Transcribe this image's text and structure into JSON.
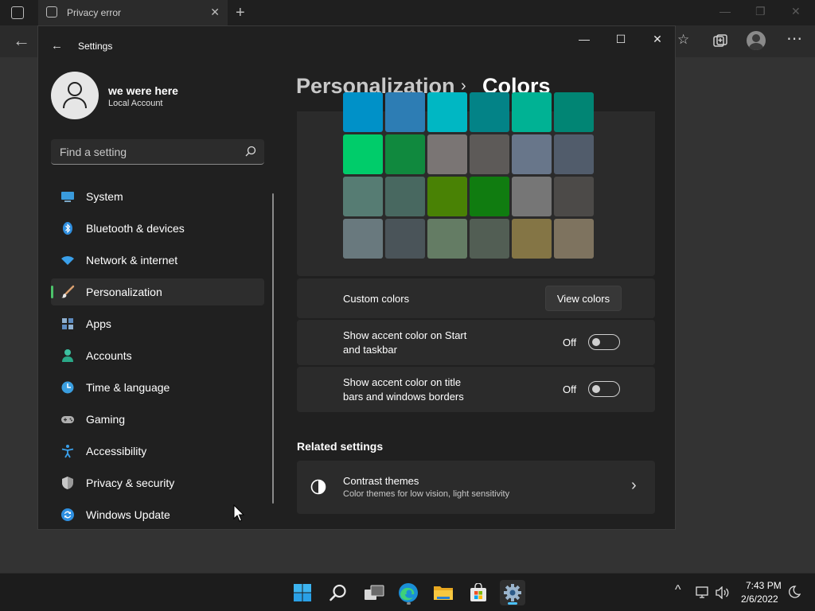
{
  "browser": {
    "tab_title": "Privacy error",
    "tab_close_glyph": "✕",
    "new_tab_glyph": "+",
    "back_glyph": "←",
    "toolbar_icons": [
      "favorites-icon",
      "collections-icon",
      "profile-icon",
      "more-icon"
    ]
  },
  "settings": {
    "app_title": "Settings",
    "back_glyph": "←",
    "window_controls": {
      "minimize": "—",
      "maximize": "☐",
      "close": "✕"
    },
    "user": {
      "name": "we were here",
      "account_type": "Local Account"
    },
    "search": {
      "placeholder": "Find a setting"
    },
    "nav": [
      {
        "label": "System",
        "icon": "system-icon"
      },
      {
        "label": "Bluetooth & devices",
        "icon": "bluetooth-icon"
      },
      {
        "label": "Network & internet",
        "icon": "network-icon"
      },
      {
        "label": "Personalization",
        "icon": "brush-icon",
        "selected": true
      },
      {
        "label": "Apps",
        "icon": "apps-icon"
      },
      {
        "label": "Accounts",
        "icon": "accounts-icon"
      },
      {
        "label": "Time & language",
        "icon": "time-language-icon"
      },
      {
        "label": "Gaming",
        "icon": "gaming-icon"
      },
      {
        "label": "Accessibility",
        "icon": "accessibility-icon"
      },
      {
        "label": "Privacy & security",
        "icon": "shield-icon"
      },
      {
        "label": "Windows Update",
        "icon": "update-icon"
      }
    ],
    "breadcrumb": {
      "parent": "Personalization",
      "separator": "›",
      "current": "Colors"
    },
    "accent_swatches": [
      [
        "#0091c8",
        "#2d7db4",
        "#00b7c3",
        "#038387",
        "#00b294",
        "#018574"
      ],
      [
        "#00cc6a",
        "#10893e",
        "#7a7574",
        "#5d5a58",
        "#68768a",
        "#515c6b"
      ],
      [
        "#567c73",
        "#486860",
        "#498205",
        "#107c10",
        "#767676",
        "#4c4a48"
      ],
      [
        "#69797e",
        "#4a5459",
        "#647c64",
        "#525e54",
        "#847545",
        "#7e735f"
      ]
    ],
    "custom_colors": {
      "label": "Custom colors",
      "button": "View colors"
    },
    "accent_start": {
      "label_line1": "Show accent color on Start",
      "label_line2": "and taskbar",
      "state": "Off",
      "on": false
    },
    "accent_title": {
      "label_line1": "Show accent color on title",
      "label_line2": "bars and windows borders",
      "state": "Off",
      "on": false
    },
    "related_heading": "Related settings",
    "contrast": {
      "title": "Contrast themes",
      "subtitle": "Color themes for low vision, light sensitivity",
      "chevron": "›"
    }
  },
  "taskbar": {
    "apps": [
      {
        "name": "start-button"
      },
      {
        "name": "search-button"
      },
      {
        "name": "task-view-button"
      },
      {
        "name": "edge-button",
        "running": true
      },
      {
        "name": "file-explorer-button"
      },
      {
        "name": "store-button"
      },
      {
        "name": "settings-button",
        "running": true,
        "active": true
      }
    ],
    "tray": {
      "chevron": "^"
    },
    "clock": {
      "time": "7:43 PM",
      "date": "2/6/2022"
    }
  },
  "colors": {
    "accent": "#4cc26a",
    "background": "#202020",
    "card": "#2b2b2b"
  }
}
